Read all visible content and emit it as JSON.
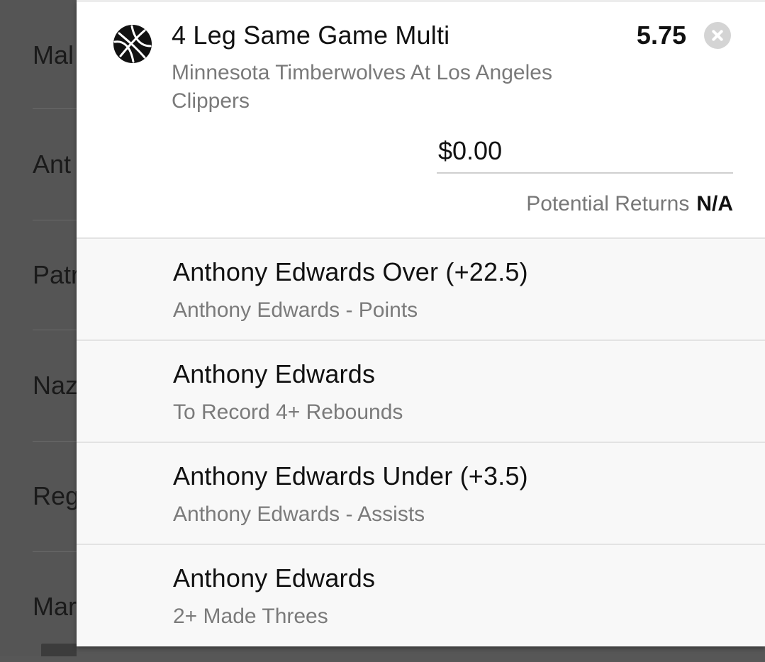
{
  "background_list": {
    "items": [
      "Mal",
      "Ant",
      "Patr",
      "Naz",
      "Reg",
      "Mar"
    ]
  },
  "bet_slip": {
    "sport_icon": "basketball-icon",
    "title": "4 Leg Same Game Multi",
    "odds": "5.75",
    "close_icon": "close-circle-icon",
    "event": "Minnesota Timberwolves At Los Angeles Clippers",
    "stake": {
      "value": "$0.00",
      "placeholder": "$0.00"
    },
    "potential_returns": {
      "label": "Potential Returns",
      "value": "N/A"
    },
    "legs": [
      {
        "title": "Anthony Edwards Over (+22.5)",
        "subtitle": "Anthony Edwards - Points"
      },
      {
        "title": "Anthony Edwards",
        "subtitle": "To Record 4+ Rebounds"
      },
      {
        "title": "Anthony Edwards Under (+3.5)",
        "subtitle": "Anthony Edwards - Assists"
      },
      {
        "title": "Anthony Edwards",
        "subtitle": "2+ Made Threes"
      }
    ]
  },
  "colors": {
    "overlay": "#575757",
    "panel": "#ffffff",
    "leg_background": "#f8f8f8",
    "muted_text": "#7a7a7a",
    "primary_text": "#111111"
  }
}
